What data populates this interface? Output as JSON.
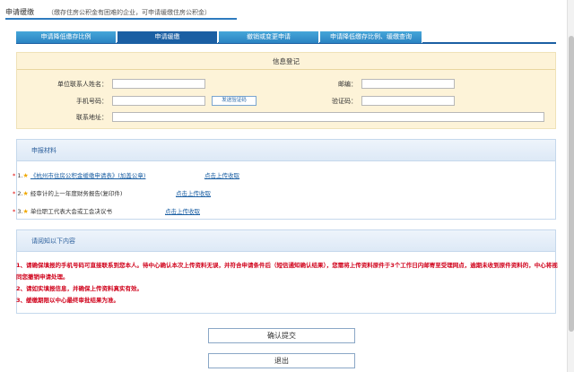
{
  "header": {
    "title": "申请缓缴",
    "subtitle": "（缴存住房公积金有困难的企业，可申请缓缴住房公积金）"
  },
  "tabs": [
    {
      "label": "申请降低缴存比例",
      "active": false
    },
    {
      "label": "申请缓缴",
      "active": true
    },
    {
      "label": "撤销或变更申请",
      "active": false
    },
    {
      "label": "申请降低缴存比例、缓缴查询",
      "active": false
    }
  ],
  "info": {
    "title": "信息登记",
    "contact_label": "单位联系人姓名：",
    "contact_value": "",
    "postcode_label": "邮编：",
    "postcode_value": "",
    "phone_label": "手机号码：",
    "phone_value": "",
    "sms_button": "发送验证码",
    "code_label": "验证码：",
    "code_value": "",
    "address_label": "联系地址：",
    "address_value": ""
  },
  "materials": {
    "title": "申报材料",
    "items": [
      {
        "required": "*",
        "num": "1.",
        "text": "《杭州市住房公积金缓缴申请表》(加盖公章)",
        "is_link": true,
        "upload": "点击上传收取"
      },
      {
        "required": "*",
        "num": "2.",
        "text": "经审计的上一年度财务报告(复印件)",
        "is_link": false,
        "upload": "点击上传收取"
      },
      {
        "required": "*",
        "num": "3.",
        "text": "单位职工代表大会或工会决议书",
        "is_link": false,
        "upload": "点击上传收取"
      }
    ]
  },
  "notes": {
    "title": "请阅知以下内容",
    "items": [
      "1、请确保填报的手机号码可直接联系到您本人。待中心确认本次上传资料无误，并符合申请条件后（短信通知确认结果），您需将上传资料原件于3个工作日内邮寄至受理网点，逾期未收到原件资料的，中心将视同您撤销申请处理。",
      "2、请如实填报信息，并确保上传资料真实有效。",
      "3、缓缴期限以中心最终审批结果为准。"
    ]
  },
  "actions": {
    "submit": "确认提交",
    "exit": "退出"
  }
}
